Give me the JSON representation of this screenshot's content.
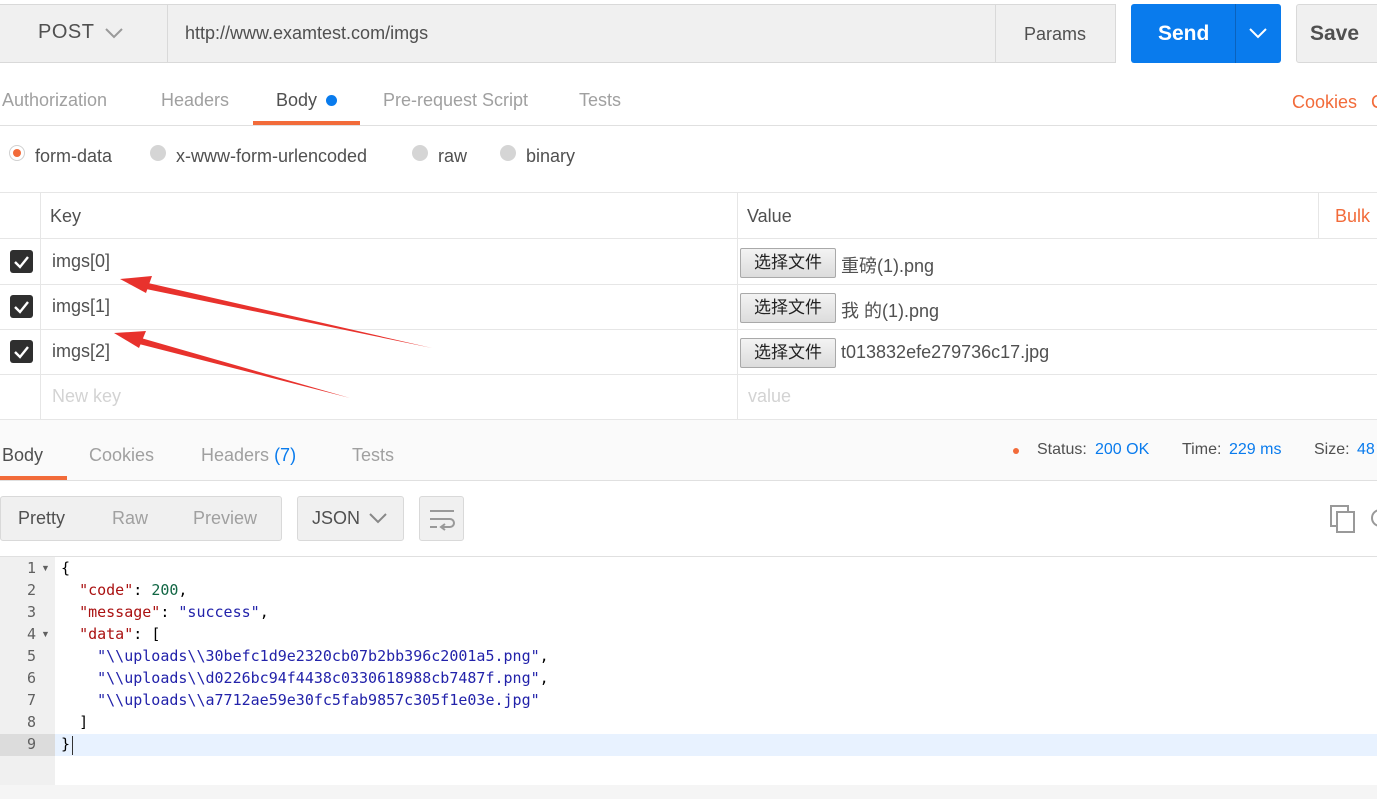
{
  "request": {
    "method": "POST",
    "url": "http://www.examtest.com/imgs",
    "params_label": "Params",
    "send_label": "Send",
    "save_label": "Save"
  },
  "req_tabs": [
    "Authorization",
    "Headers",
    "Body",
    "Pre-request Script",
    "Tests"
  ],
  "cookies_link": "Cookies",
  "cookies_extra": "C",
  "body_modes": [
    "form-data",
    "x-www-form-urlencoded",
    "raw",
    "binary"
  ],
  "table": {
    "key_header": "Key",
    "value_header": "Value",
    "bulk_label": "Bulk",
    "file_button": "选择文件",
    "rows": [
      {
        "key": "imgs[0]",
        "file": "重磅(1).png"
      },
      {
        "key": "imgs[1]",
        "file": "我 的(1).png"
      },
      {
        "key": "imgs[2]",
        "file": "t013832efe279736c17.jpg"
      }
    ],
    "new_key_placeholder": "New key",
    "new_value_placeholder": "value"
  },
  "resp_tabs": {
    "body": "Body",
    "cookies": "Cookies",
    "headers": "Headers",
    "headers_count": "(7)",
    "tests": "Tests"
  },
  "status": {
    "status_label": "Status:",
    "status_value": "200 OK",
    "time_label": "Time:",
    "time_value": "229 ms",
    "size_label": "Size:",
    "size_value": "48"
  },
  "view_modes": [
    "Pretty",
    "Raw",
    "Preview"
  ],
  "format": "JSON",
  "code": {
    "line_numbers": [
      "1",
      "2",
      "3",
      "4",
      "5",
      "6",
      "7",
      "8",
      "9"
    ],
    "open_brace": "{",
    "code_key": "\"code\"",
    "code_value": "200",
    "message_key": "\"message\"",
    "message_value": "\"success\"",
    "data_key": "\"data\"",
    "open_bracket": "[",
    "data": [
      "\"\\\\uploads\\\\30befc1d9e2320cb07b2bb396c2001a5.png\"",
      "\"\\\\uploads\\\\d0226bc94f4438c0330618988cb7487f.png\"",
      "\"\\\\uploads\\\\a7712ae59e30fc5fab9857c305f1e03e.jpg\""
    ],
    "close_bracket": "]",
    "close_brace": "}"
  },
  "colors": {
    "accent": "#f26b3a",
    "primary": "#097bed",
    "arrow": "#e8322d"
  }
}
